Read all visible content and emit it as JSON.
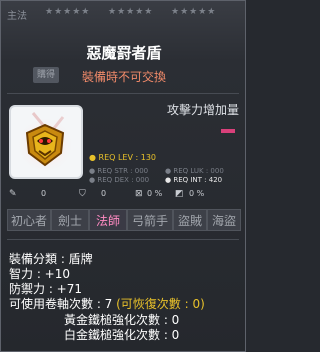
{
  "background_text": "主法",
  "background_button": "購得",
  "star_groups": [
    "★★★★★",
    "★★★★★",
    "★★★★★"
  ],
  "item": {
    "name": "惡魔罸者盾",
    "tradeable_status": "裝備時不可交換",
    "icon": "demon-shield-icon",
    "attack_increase_label": "攻擊力增加量"
  },
  "requirements": {
    "level": "● REQ LEV : 130",
    "str": "● REQ STR : 000",
    "luk": "● REQ LUK : 000",
    "dex": "● REQ DEX : 000",
    "int": "● REQ INT : 420"
  },
  "small_stats": [
    "0",
    "0",
    "0 %",
    "0 %"
  ],
  "jobs": [
    {
      "label": "初心者",
      "active": false
    },
    {
      "label": "劍士",
      "active": false
    },
    {
      "label": "法師",
      "active": true
    },
    {
      "label": "弓箭手",
      "active": false
    },
    {
      "label": "盜賊",
      "active": false
    },
    {
      "label": "海盜",
      "active": false
    }
  ],
  "stats": {
    "category": "裝備分類 : 盾牌",
    "int": "智力 : +10",
    "defense": "防禦力 : +71",
    "upgrades_label": "可使用卷軸次數 : 7 ",
    "upgrades_recover": "(可恢復次數 : 0)",
    "gold_hammer": "黃金鐵槌強化次數 : 0",
    "platinum_hammer": "白金鐵槌強化次數 : 0"
  },
  "colors": {
    "accent_red": "#f28b6a",
    "yellow": "#e8c12a",
    "mage_pink": "#ff8ac2"
  }
}
